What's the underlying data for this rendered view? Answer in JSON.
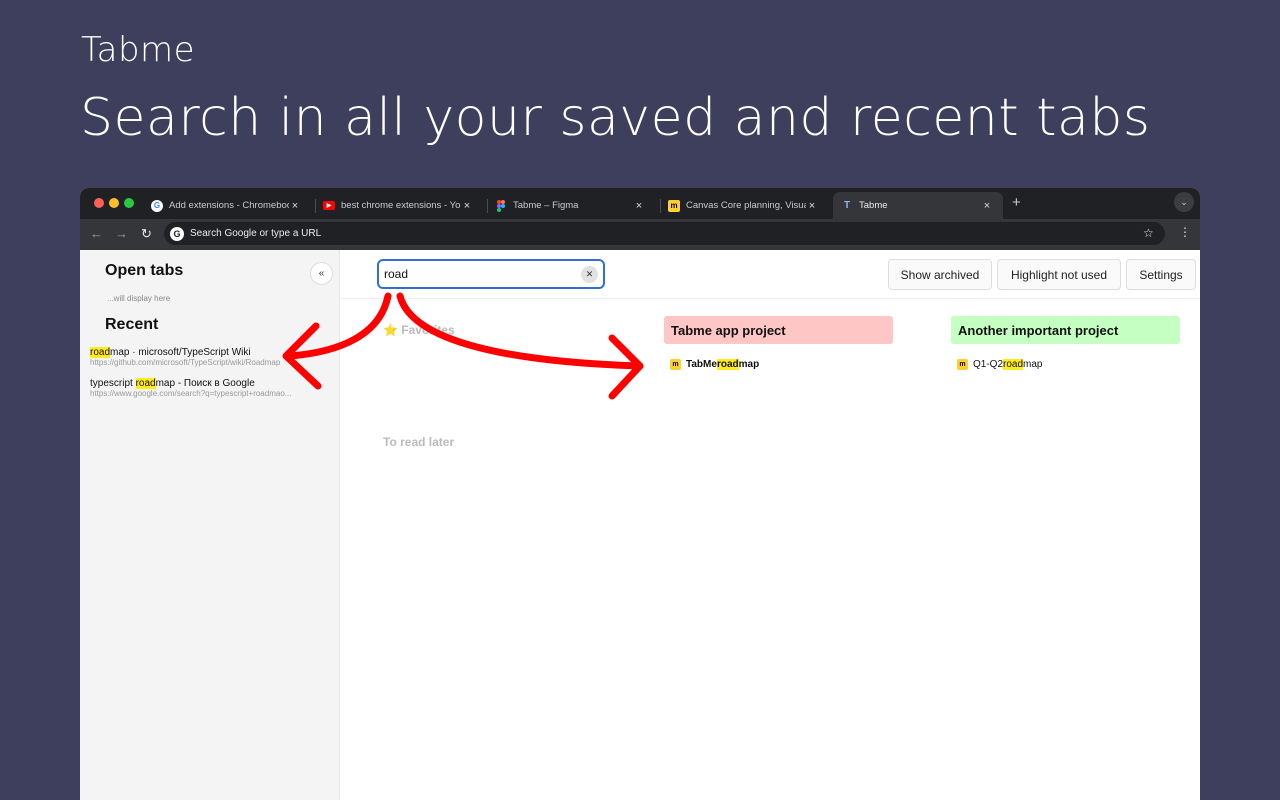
{
  "promo": {
    "brand": "Tabme",
    "headline": "Search in all your saved and recent tabs"
  },
  "browser": {
    "tabs": [
      {
        "title": "Add extensions - Chromebook",
        "icon": "google-icon"
      },
      {
        "title": "best chrome extensions - YouTube",
        "icon": "youtube-icon"
      },
      {
        "title": "Tabme – Figma",
        "icon": "figma-icon"
      },
      {
        "title": "Canvas Core planning, Visual",
        "icon": "miro-icon"
      },
      {
        "title": "Tabme",
        "icon": "tabme-icon",
        "icon_letter": "T",
        "active": true
      }
    ],
    "new_tab_symbol": "+",
    "omnibox_placeholder": "Search Google or type a URL"
  },
  "sidebar": {
    "open_tabs_title": "Open tabs",
    "open_tabs_note": "...will display here",
    "recent_title": "Recent",
    "collapse_symbol": "«",
    "recent": [
      {
        "title_hl": "road",
        "title_rest": "map · microsoft/TypeScript Wiki",
        "title_pre": "",
        "url": "https://github.com/microsoft/TypeScript/wiki/Roadmap"
      },
      {
        "title_pre": "typescript ",
        "title_hl": "road",
        "title_rest": "map - Поиск в Google",
        "url": "https://www.google.com/search?q=typescript+roadmao..."
      }
    ]
  },
  "main": {
    "search_value": "road",
    "buttons": {
      "show_archived": "Show archived",
      "highlight_not_used": "Highlight not used",
      "settings": "Settings"
    },
    "favorites_label": "⭐ Favorites",
    "to_read_later_label": "To read later",
    "folders": [
      {
        "title": "Tabme app project",
        "color": "#ffc6c6",
        "item_pre": "TabMe ",
        "item_hl": "road",
        "item_rest": "map",
        "item_bold": true
      },
      {
        "title": "Another important project",
        "color": "#c6ffc2",
        "item_pre": "Q1-Q2 ",
        "item_hl": "road",
        "item_rest": "map",
        "item_bold": false
      }
    ]
  },
  "colors": {
    "background": "#3d3f5c",
    "arrow": "#ff0000",
    "highlight": "#ffeb1a",
    "search_border": "#2f6fd6"
  }
}
